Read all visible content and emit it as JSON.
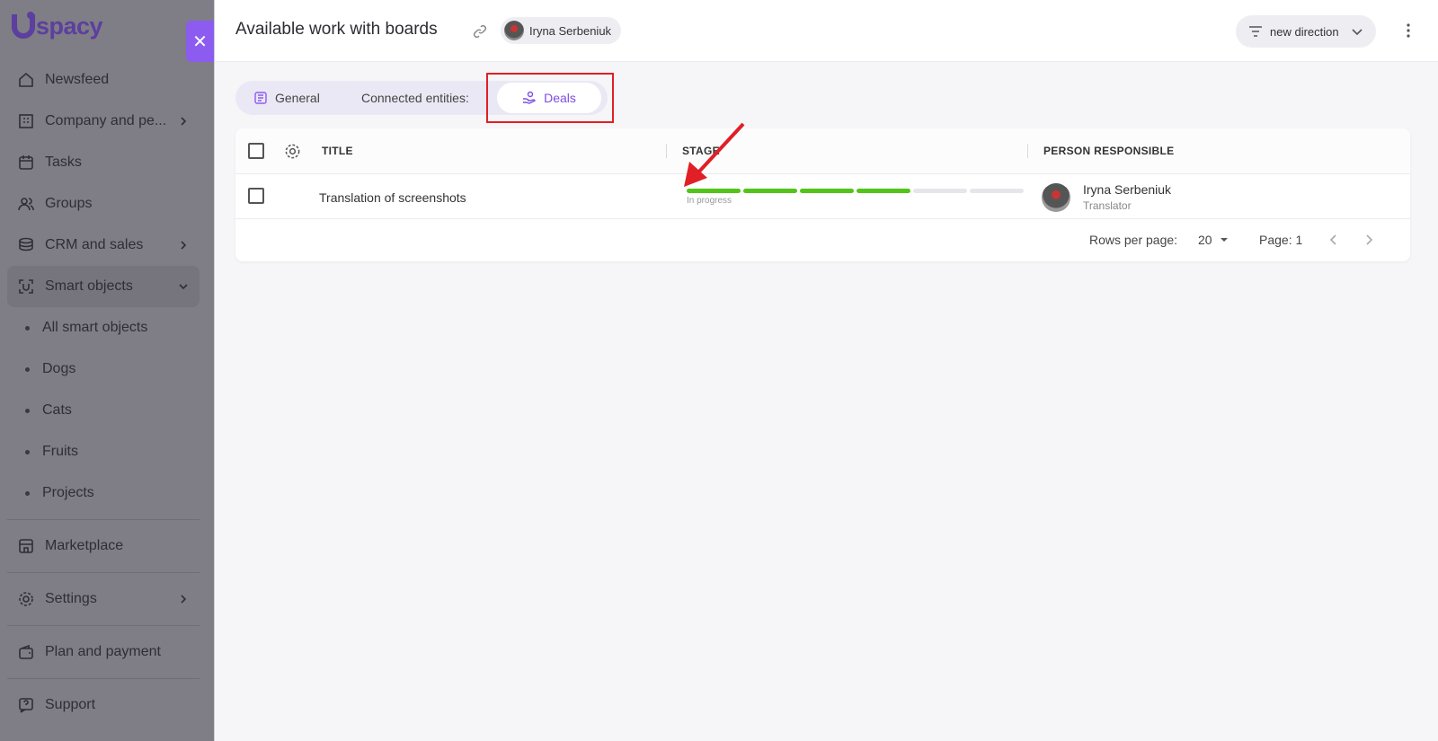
{
  "brand": {
    "name": "spacy",
    "accent": "#8c5cf0",
    "logo_color": "#5c3f9e"
  },
  "sidebar": {
    "items": [
      {
        "label": "Newsfeed",
        "icon": "home-icon"
      },
      {
        "label": "Company and pe...",
        "icon": "building-icon",
        "has_submenu": true
      },
      {
        "label": "Tasks",
        "icon": "calendar-icon"
      },
      {
        "label": "Groups",
        "icon": "users-icon"
      },
      {
        "label": "CRM and sales",
        "icon": "coins-icon",
        "has_submenu": true
      },
      {
        "label": "Smart objects",
        "icon": "scan-icon",
        "expanded": true
      }
    ],
    "sub_items": [
      "All smart objects",
      "Dogs",
      "Cats",
      "Fruits",
      "Projects"
    ],
    "bottom_items": [
      {
        "label": "Marketplace",
        "icon": "store-icon"
      },
      {
        "label": "Settings",
        "icon": "gear-icon",
        "has_submenu": true
      },
      {
        "label": "Plan and payment",
        "icon": "wallet-icon"
      },
      {
        "label": "Support",
        "icon": "help-icon"
      }
    ]
  },
  "panel": {
    "title": "Available work with boards",
    "user_chip": "Iryna Serbeniuk",
    "direction": "new direction"
  },
  "tabs": {
    "general": "General",
    "connected_label": "Connected entities:",
    "deals": "Deals"
  },
  "table": {
    "columns": {
      "title": "TITLE",
      "stage": "STAGE",
      "person": "PERSON RESPONSIBLE"
    },
    "rows": [
      {
        "title": "Translation of screenshots",
        "stage_label": "In progress",
        "stage_done": 4,
        "stage_total": 6,
        "person_name": "Iryna Serbeniuk",
        "person_role": "Translator"
      }
    ],
    "rows_per_page_label": "Rows per page:",
    "rows_per_page": "20",
    "page_label": "Page: 1"
  },
  "colors": {
    "highlight": "#e01f26",
    "stage_done": "#52c41a"
  }
}
